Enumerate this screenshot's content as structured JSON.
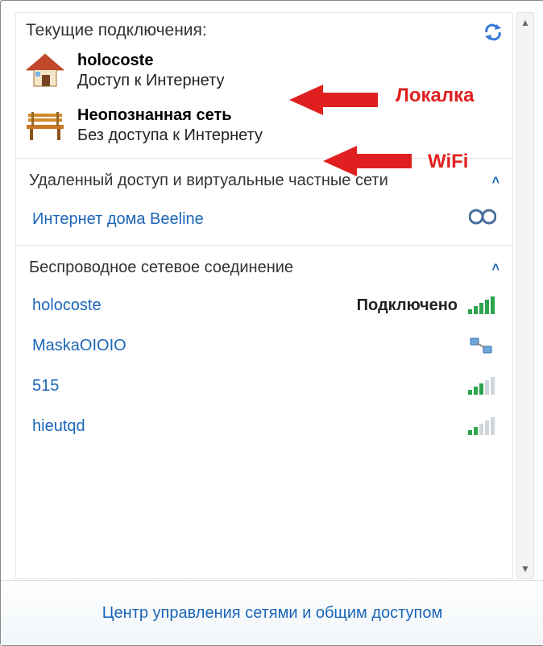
{
  "header": {
    "title": "Текущие подключения:",
    "refresh_icon": "refresh-icon"
  },
  "current_connections": [
    {
      "icon": "house-icon",
      "name": "holocoste",
      "status": "Доступ к Интернету",
      "annotation": "Локалка"
    },
    {
      "icon": "bench-icon",
      "name": "Неопознанная сеть",
      "status": "Без доступа к Интернету",
      "annotation": "WiFi"
    }
  ],
  "sections": {
    "dialup": {
      "title": "Удаленный доступ и виртуальные частные сети",
      "expanded": true,
      "items": [
        {
          "name": "Интернет дома Beeline",
          "icon": "vpn-icon"
        }
      ]
    },
    "wireless": {
      "title": "Беспроводное сетевое соединение",
      "expanded": true,
      "items": [
        {
          "name": "holocoste",
          "status": "Подключено",
          "signal": 5,
          "icon": "signal-5"
        },
        {
          "name": "MaskaOIOIO",
          "status": "",
          "signal": 0,
          "icon": "signal-network"
        },
        {
          "name": "515",
          "status": "",
          "signal": 3,
          "icon": "signal-3"
        },
        {
          "name": "hieutqd",
          "status": "",
          "signal": 2,
          "icon": "signal-2"
        }
      ]
    }
  },
  "footer": {
    "link": "Центр управления сетями и общим доступом"
  },
  "colors": {
    "link": "#1b66b8",
    "annotation": "#e02020"
  }
}
